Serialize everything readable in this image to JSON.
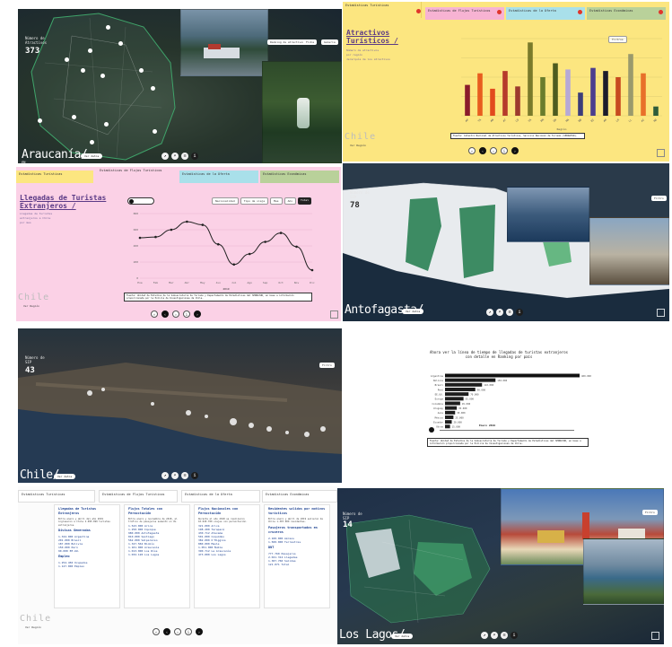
{
  "panels": {
    "araucania": {
      "count_label": "Número de Atractivos",
      "count": "373",
      "title": "Araucanía/",
      "pill": "Ver datos",
      "photo_buttons": [
        "Ranking de atractivos",
        "Ficha",
        "Galería"
      ]
    },
    "atractivos": {
      "tabs": [
        "Estadísticas Turísticas",
        "Estadísticas de Flujos Turísticos",
        "Estadísticas de la Oferta",
        "Estadísticas Económicas"
      ],
      "title": "Atractivos Turísticos /",
      "sub": [
        "Número de atractivos",
        "por región",
        "Jerarquía de los atractivos"
      ],
      "filter_button": "Filtros",
      "note": "Fuente: Catastro Nacional de Atractivos Turísticos, Servicio Nacional de Turismo (SERNATUR).",
      "faded": "Chile",
      "back": "Ver Región",
      "chart_data": {
        "type": "bar",
        "categories": [
          "AP",
          "TA",
          "AN",
          "AT",
          "CO",
          "VA",
          "RM",
          "OH",
          "MA",
          "NB",
          "BI",
          "AR",
          "LR",
          "LL",
          "AI",
          "MG"
        ],
        "values": [
          40,
          55,
          35,
          58,
          38,
          95,
          50,
          68,
          60,
          30,
          62,
          58,
          50,
          80,
          55,
          12
        ],
        "colors": [
          "#8a1c2b",
          "#e85d1e",
          "#e24a1d",
          "#b63b2b",
          "#9c3a2d",
          "#7a7a2a",
          "#6a7d2c",
          "#4e5c1f",
          "#b6a9d6",
          "#3c3c7a",
          "#4c3f8e",
          "#1c1c2c",
          "#c74a1f",
          "#9a9a6c",
          "#e8702a",
          "#2f5c3a"
        ],
        "ylim": [
          0,
          100
        ],
        "xlabel": "Región",
        "ylabel": ""
      }
    },
    "llegadas": {
      "tabs": [
        "Estadísticas Turísticas",
        "Estadísticas de Flujos Turísticos",
        "Estadísticas de la Oferta",
        "Estadísticas Económicas"
      ],
      "title": "Llegadas de Turistas Extranjeros /",
      "sub": [
        "Llegadas de turistas",
        "extranjeros a Chile",
        "por mes"
      ],
      "filters": [
        "Nacionalidad",
        "Tipo de viaje",
        "Mes",
        "Año",
        "Total"
      ],
      "note": "Fuente: Unidad de Estudios de la Subsecretaría de Turismo y Departamento de Estadísticas del SERNATUR, en base a información proporcionada por la Policía de Investigaciones de Chile.",
      "faded": "Chile",
      "back": "Ver Región",
      "chart_data": {
        "type": "line",
        "x": [
          "Ene",
          "Feb",
          "Mar",
          "Abr",
          "May",
          "Jun",
          "Jul",
          "Ago",
          "Sep",
          "Oct",
          "Nov",
          "Dic"
        ],
        "values": [
          500,
          510,
          600,
          700,
          660,
          420,
          170,
          300,
          450,
          560,
          390,
          100
        ],
        "ylim": [
          0,
          800
        ],
        "legend": "2019"
      }
    },
    "antofagasta": {
      "count_label": "Número de SIP",
      "count": "78",
      "title": "Antofagasta/",
      "pill": "Ver datos",
      "button": "Filtro"
    },
    "chile": {
      "count_label": "Número de SIP",
      "count": "43",
      "title": "Chile/",
      "pill": "Ver datos",
      "button": "Filtro"
    },
    "timeline": {
      "heading": "Ahora ver la línea de tiempo de llegadas de turistas extranjeros con detalle en Ranking por país",
      "year_label": "Enero 2019",
      "note": "Fuente: Unidad de Estudios de la Subsecretaría de Turismo y Departamento de Estadísticas del SERNATUR, en base a información proporcionada por la Policía de Investigaciones de Chile.",
      "chart_data": {
        "type": "bar",
        "categories": [
          "Argentina",
          "Bolivia",
          "Brasil",
          "Perú",
          "EE.UU.",
          "Europa",
          "Colombia",
          "Uruguay",
          "Asia",
          "México",
          "Ecuador",
          "Otros"
        ],
        "values": [
          400,
          150,
          110,
          90,
          70,
          55,
          45,
          35,
          30,
          25,
          20,
          15
        ],
        "data_labels": [
          "400.000",
          "150.000",
          "110.000",
          "90.000",
          "70.000",
          "55.000",
          "45.000",
          "35.000",
          "30.000",
          "25.000",
          "20.000",
          "15.000"
        ],
        "xlim": [
          0,
          400
        ]
      }
    },
    "cards": {
      "tabs": [
        "Estadísticas Turísticas",
        "Estadísticas de Flujos Turísticos",
        "Estadísticas de la Oferta",
        "Estadísticas Económicas"
      ],
      "faded": "Chile",
      "back": "Ver Región",
      "columns": [
        {
          "title": "Llegadas de Turistas Extranjeros",
          "text": "Entre enero y abril del año 2019 ingresaron a Chile 2.095.099 turistas extranjeros.",
          "sub_title": "Divisas Generadas",
          "rows": [
            "1.324.000 Argentina",
            "201.000 Brasil",
            "187.000 Bolivia",
            "150.000 Perú",
            "90.000 EE.UU."
          ],
          "sub_title2": "Empleo",
          "rows2": [
            "1.254.450 Ocupados",
            "1.127.000 Empleo"
          ]
        },
        {
          "title": "Flujos Totales con Pernoctación",
          "text": "Entre enero y noviembre de 2018, el tráfico de pasajeros aumentó un 4%.",
          "sub_title": "",
          "rows": [
            "1.543.000 Arica",
            "1.250.000 Iquique",
            "980.000 Antofagasta",
            "810.000 Santiago",
            "562.000 Valparaíso"
          ],
          "sub_title2": "",
          "rows2": [
            "1.327.562 Biobío",
            "1.101.000 Araucanía",
            "1.013.000 Los Ríos",
            "1.032.120 Los Lagos"
          ]
        },
        {
          "title": "Flujos Nacionales con Pernoctación",
          "text": "Durante el año 2018 se realizaron 10.020.700 viajes con pernoctación.",
          "sub_title": "",
          "rows": [
            "321.000 Arica",
            "198.200 Tarapacá",
            "430.712 Atacama",
            "501.000 Coquimbo",
            "382.000 O'Higgins"
          ],
          "sub_title2": "",
          "rows2": [
            "880.000 Maule",
            "1.051.000 Ñuble",
            "390.712 La Araucanía",
            "473.000 Los Lagos"
          ]
        },
        {
          "title": "Residentes salidos por motivos turísticos",
          "text": "Entre enero y abril de 2019 salieron de Chile 1.307.000 residentes.",
          "sub_title": "Pasajeros transportados en cruceros",
          "rows": [
            "2.100.000 Aéreos",
            "1.500.000 Terrestres"
          ],
          "sub_title2": "DNT",
          "rows2": [
            "777.760 Pasajeros",
            "2.021.312 Llegadas",
            "1.307.760 Salidas",
            "121.071 Total"
          ]
        }
      ]
    },
    "loslagos": {
      "count_label": "Número de SIP",
      "count": "14",
      "title": "Los Lagos/",
      "pill": "Ver datos",
      "button": "Filtro"
    }
  }
}
